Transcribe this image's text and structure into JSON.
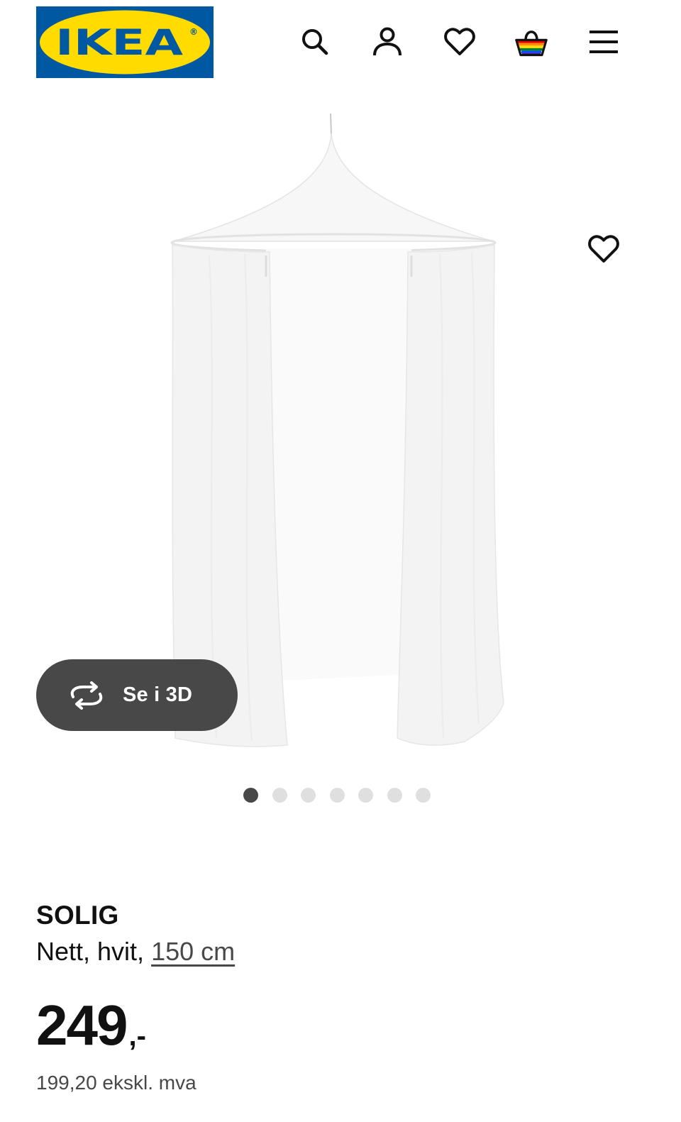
{
  "header": {
    "logo_text": "IKEA",
    "logo_registered": "®",
    "brand_colors": {
      "blue": "#0058a3",
      "yellow": "#ffdb00"
    },
    "icons": [
      "search-icon",
      "user-icon",
      "heart-icon",
      "shopping-bag-icon",
      "hamburger-menu-icon"
    ]
  },
  "gallery": {
    "view_3d_label": "Se i 3D",
    "dots_total": 7,
    "dots_active_index": 0
  },
  "product": {
    "name": "SOLIG",
    "desc_prefix": "Nett, hvit, ",
    "desc_size": "150 cm",
    "price_integer": "249",
    "price_suffix": ",-",
    "price_excl_vat": "199,20 ekskl. mva"
  },
  "colors": {
    "text": "#111111",
    "secondary_text": "#484848",
    "button_dark": "#484848",
    "dot_inactive": "#dfdfdf"
  }
}
